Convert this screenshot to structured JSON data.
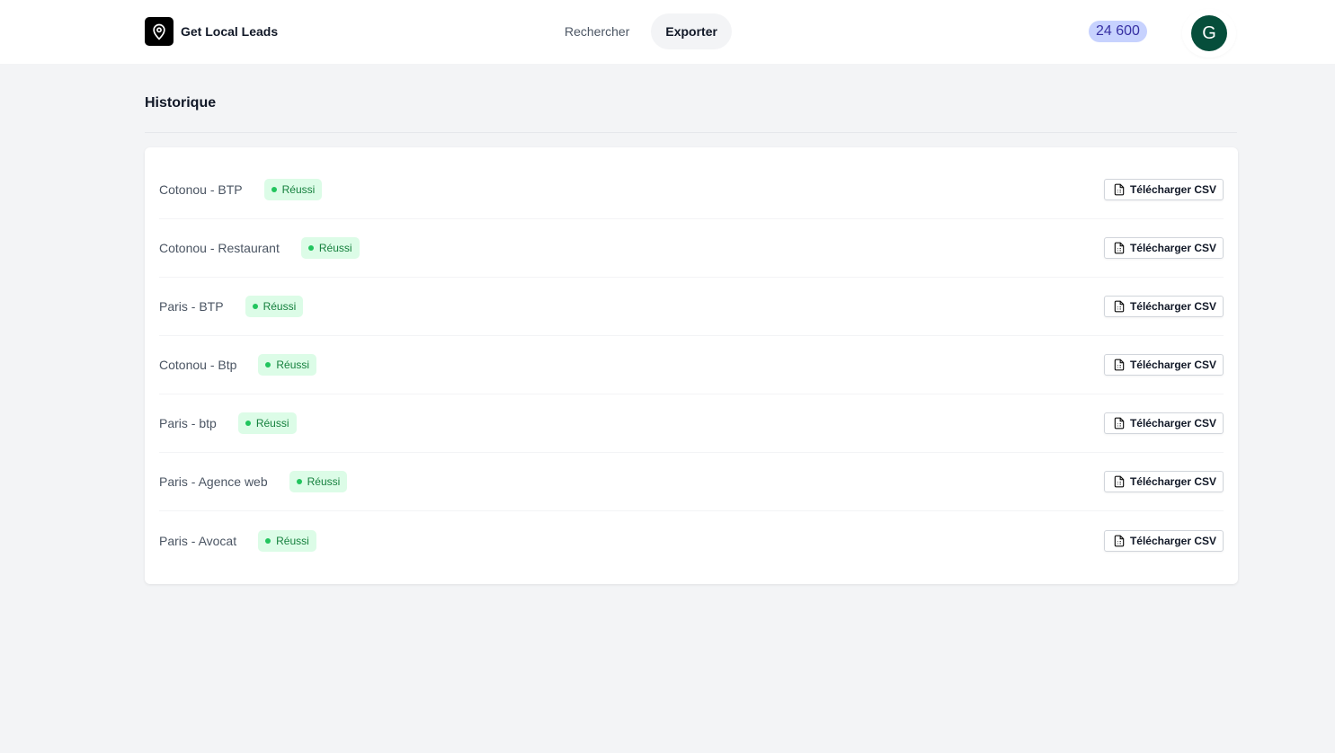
{
  "app": {
    "name": "Get Local Leads"
  },
  "nav": [
    {
      "label": "Rechercher"
    },
    {
      "label": "Exporter",
      "active": true
    }
  ],
  "credits": "24 600",
  "user": {
    "initial": "G"
  },
  "page": {
    "title": "Historique"
  },
  "download_label": "Télécharger CSV",
  "exports": [
    {
      "name": "Cotonou - BTP",
      "status": "Réussi"
    },
    {
      "name": "Cotonou - Restaurant",
      "status": "Réussi"
    },
    {
      "name": "Paris - BTP",
      "status": "Réussi"
    },
    {
      "name": "Cotonou - Btp",
      "status": "Réussi"
    },
    {
      "name": "Paris - btp",
      "status": "Réussi"
    },
    {
      "name": "Paris - Agence web",
      "status": "Réussi"
    },
    {
      "name": "Paris - Avocat",
      "status": "Réussi"
    }
  ],
  "colors": {
    "success_bg": "#dcfce7",
    "success_text": "#15803d",
    "avatar": "#064e3b",
    "credits_bg": "#c7d2fe"
  }
}
